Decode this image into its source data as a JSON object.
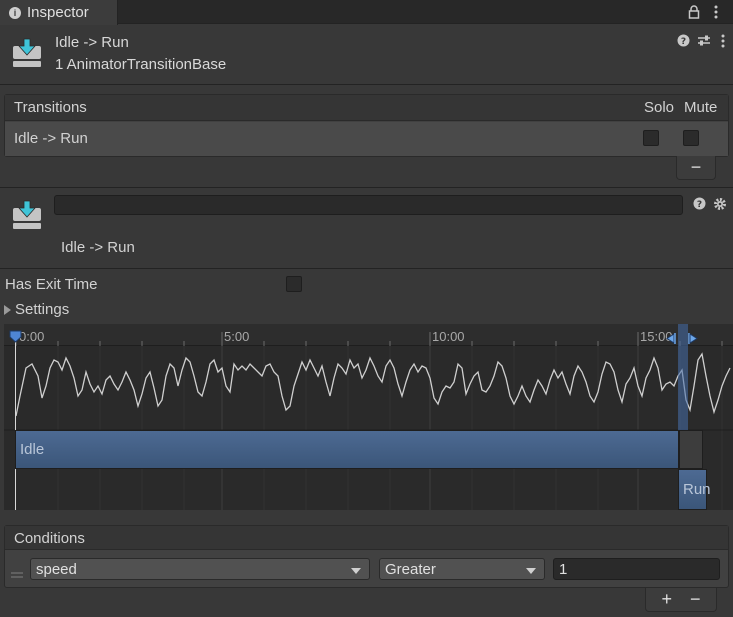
{
  "window": {
    "tab_label": "Inspector"
  },
  "header": {
    "name": "Idle -> Run",
    "type_label": "1 AnimatorTransitionBase"
  },
  "transitions": {
    "title": "Transitions",
    "col_solo": "Solo",
    "col_mute": "Mute",
    "rows": [
      {
        "label": "Idle -> Run",
        "solo": false,
        "mute": false
      }
    ],
    "remove_label": "−"
  },
  "transition_detail": {
    "name_value": "",
    "caption": "Idle -> Run"
  },
  "has_exit_time": {
    "label": "Has Exit Time",
    "checked": false
  },
  "settings": {
    "label": "Settings",
    "expanded": false
  },
  "timeline": {
    "ticks": [
      "0:00",
      "5:00",
      "10:00",
      "15:00"
    ],
    "idle_label": "Idle",
    "run_label": "Run"
  },
  "conditions": {
    "title": "Conditions",
    "rows": [
      {
        "parameter": "speed",
        "mode": "Greater",
        "threshold": "1"
      }
    ],
    "add_label": "+",
    "remove_label": "−"
  }
}
